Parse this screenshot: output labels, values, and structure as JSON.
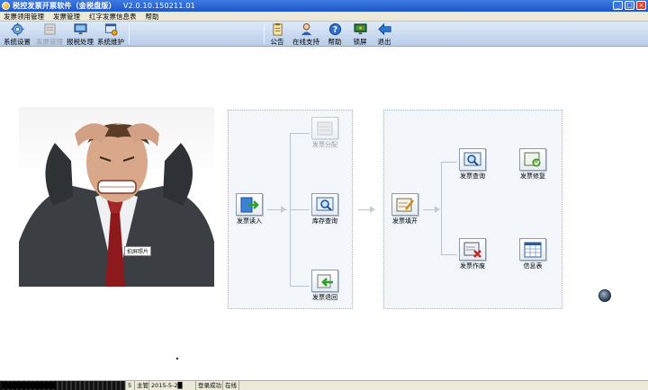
{
  "window": {
    "title": "税控发票开票软件（金税盘版）",
    "version": "V2.0.10.150211.01",
    "minimize": "_",
    "maximize": "□",
    "close": "×"
  },
  "menu": [
    "发票领用管理",
    "发票管理",
    "红字发票信息表",
    "帮助"
  ],
  "toolbar": {
    "left": [
      {
        "label": "系统设置",
        "enabled": true
      },
      {
        "label": "发票管理",
        "enabled": false
      },
      {
        "label": "报税处理",
        "enabled": true
      },
      {
        "label": "系统维护",
        "enabled": true
      }
    ],
    "right": [
      {
        "label": "公告"
      },
      {
        "label": "在线支持"
      },
      {
        "label": "帮助"
      },
      {
        "label": "锁屏"
      },
      {
        "label": "退出"
      }
    ]
  },
  "photo": {
    "tag": "拍屏照片"
  },
  "flow": {
    "panel1": {
      "entry": "发票读入",
      "branches": [
        "发票分配",
        "库存查询",
        "发票退回"
      ]
    },
    "panel2": {
      "entry": "发票填开",
      "nodes": [
        "发票查询",
        "发票修复",
        "发票作废",
        "信息表"
      ]
    }
  },
  "status": {
    "company": "████████████",
    "code": "5",
    "user": "主管",
    "date": "2015-5-2█",
    "login": "登录成功",
    "state": "在线"
  }
}
